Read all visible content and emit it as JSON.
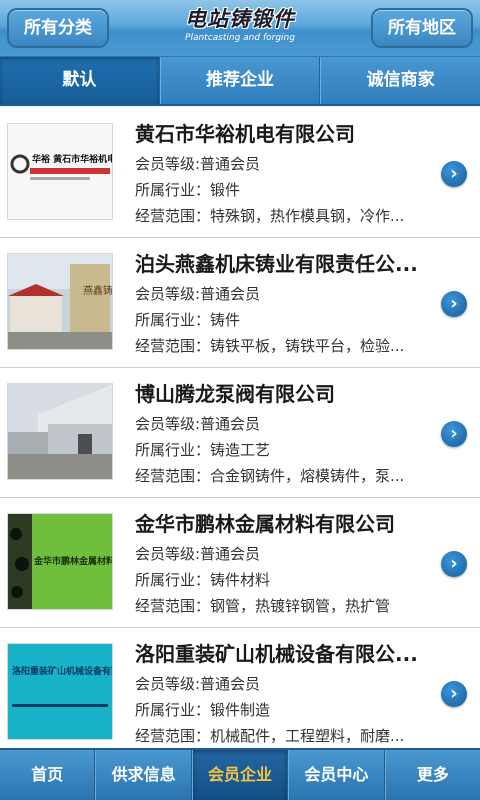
{
  "header": {
    "left_button": "所有分类",
    "right_button": "所有地区",
    "logo_main": "电站铸锻件",
    "logo_sub": "Plantcasting and forging"
  },
  "tabs": [
    {
      "label": "默认",
      "active": true
    },
    {
      "label": "推荐企业",
      "active": false
    },
    {
      "label": "诚信商家",
      "active": false
    }
  ],
  "companies": [
    {
      "name": "黄石市华裕机电有限公司",
      "level": "会员等级:普通会员",
      "industry": "所属行业：锻件",
      "scope": "经营范围：特殊钢，热作模具钢，冷作...",
      "thumb_text": "华裕 黄石市华裕机电有限公司"
    },
    {
      "name": "泊头燕鑫机床铸业有限责任公...",
      "level": "会员等级:普通会员",
      "industry": "所属行业：铸件",
      "scope": "经营范围：铸铁平板，铸铁平台，检验...",
      "thumb_text": "燕鑫铸业"
    },
    {
      "name": "博山腾龙泵阀有限公司",
      "level": "会员等级:普通会员",
      "industry": "所属行业：铸造工艺",
      "scope": "经营范围：合金钢铸件，熔模铸件，泵...",
      "thumb_text": ""
    },
    {
      "name": "金华市鹏林金属材料有限公司",
      "level": "会员等级:普通会员",
      "industry": "所属行业：铸件材料",
      "scope": "经营范围：钢管，热镀锌钢管，热扩管",
      "thumb_text": "金华市鹏林金属材料有限公司"
    },
    {
      "name": "洛阳重装矿山机械设备有限公...",
      "level": "会员等级:普通会员",
      "industry": "所属行业：锻件制造",
      "scope": "经营范围：机械配件，工程塑料，耐磨...",
      "thumb_text": "洛阳重装矿山机械设备有限公司"
    }
  ],
  "bottom_nav": [
    {
      "label": "首页",
      "active": false
    },
    {
      "label": "供求信息",
      "active": false
    },
    {
      "label": "会员企业",
      "active": true
    },
    {
      "label": "会员中心",
      "active": false
    },
    {
      "label": "更多",
      "active": false
    }
  ],
  "colors": {
    "header_blue": "#4b9ad3",
    "active_nav_text": "#f6c443"
  }
}
